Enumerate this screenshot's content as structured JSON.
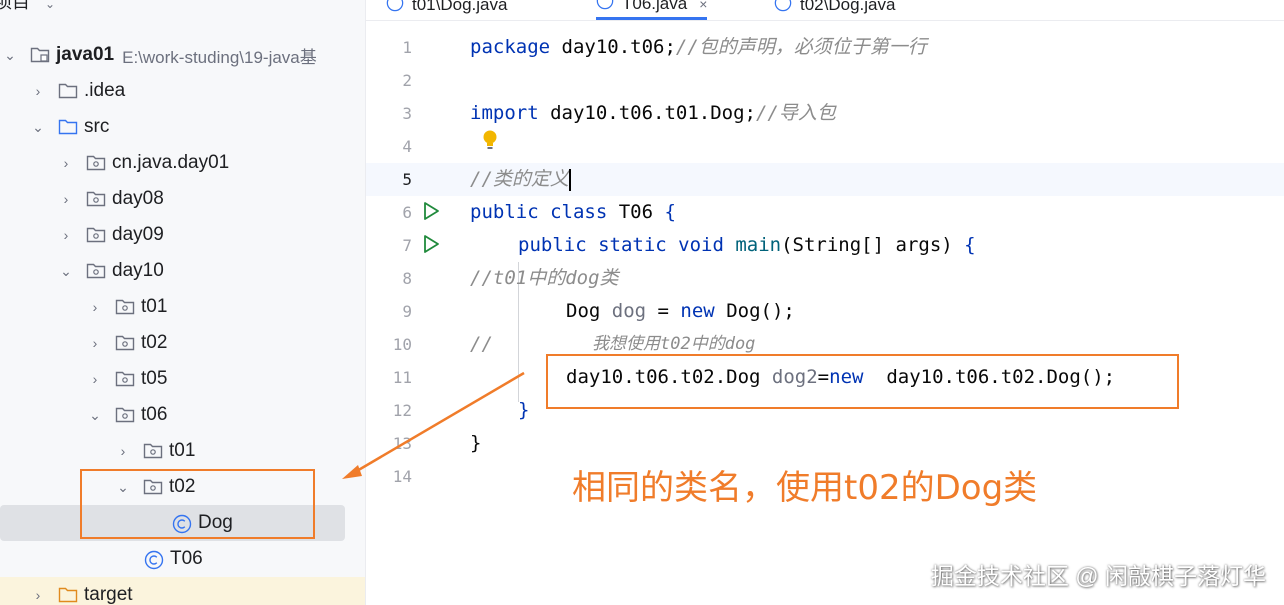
{
  "project_panel": {
    "header_title": "项目",
    "tree": [
      {
        "label": "java01",
        "path": "E:\\work-studing\\19-java基",
        "type": "module",
        "expanded": true
      },
      {
        "label": ".idea",
        "type": "folder",
        "expanded": false
      },
      {
        "label": "src",
        "type": "source-folder",
        "expanded": true
      },
      {
        "label": "cn.java.day01",
        "type": "package",
        "expanded": false
      },
      {
        "label": "day08",
        "type": "package",
        "expanded": false
      },
      {
        "label": "day09",
        "type": "package",
        "expanded": false
      },
      {
        "label": "day10",
        "type": "package",
        "expanded": true
      },
      {
        "label": "t01",
        "type": "package",
        "expanded": false
      },
      {
        "label": "t02",
        "type": "package",
        "expanded": false
      },
      {
        "label": "t05",
        "type": "package",
        "expanded": false
      },
      {
        "label": "t06",
        "type": "package",
        "expanded": true
      },
      {
        "label": "t01",
        "type": "package",
        "expanded": false
      },
      {
        "label": "t02",
        "type": "package",
        "expanded": true
      },
      {
        "label": "Dog",
        "type": "class",
        "selected": true
      },
      {
        "label": "T06",
        "type": "class"
      },
      {
        "label": "target",
        "type": "folder",
        "expanded": false
      }
    ]
  },
  "editor": {
    "tabs": [
      {
        "label": "t01\\Dog.java",
        "active": false
      },
      {
        "label": "T06.java",
        "active": true,
        "close": "×"
      },
      {
        "label": "t02\\Dog.java",
        "active": false
      }
    ],
    "line_numbers": [
      "1",
      "2",
      "3",
      "4",
      "5",
      "6",
      "7",
      "8",
      "9",
      "10",
      "11",
      "12",
      "13",
      "14"
    ],
    "current_line": "5",
    "code": {
      "l1_kw": "package",
      "l1_pkg": " day10.t06;",
      "l1_cm": "//包的声明，必须位于第一行",
      "l3_kw": "import",
      "l3_pkg": " day10.t06.t01.Dog;",
      "l3_cm": "//导入包",
      "l5_cm": "//类的定义",
      "l6_kw": "public class",
      "l6_name": " T06 ",
      "l6_brace": "{",
      "l7_kw": "public static void",
      "l7_fn": " main",
      "l7_rest": "(String[] args) ",
      "l7_brace": "{",
      "l8_cm": "//t01中的dog类",
      "l9_type": "Dog ",
      "l9_var": "dog",
      "l9_eq": " = ",
      "l9_kw": "new",
      "l9_rest": " Dog();",
      "l10_cm": "//",
      "l10_cm2": "我想使用t02中的dog",
      "l11_type": "day10.t06.t02.Dog ",
      "l11_var": "dog2",
      "l11_eq": "=",
      "l11_kw": "new",
      "l11_rest": "  day10.t06.t02.Dog();",
      "l12_brace": "}",
      "l13_brace": "}"
    }
  },
  "annotation_text": "相同的类名，使用t02的Dog类",
  "watermark": "掘金技术社区 @ 闲敲棋子落灯华",
  "colors": {
    "accent": "#f07c2a",
    "keyword": "#0033b3",
    "comment": "#8c8c8c",
    "run": "#208a3c"
  }
}
